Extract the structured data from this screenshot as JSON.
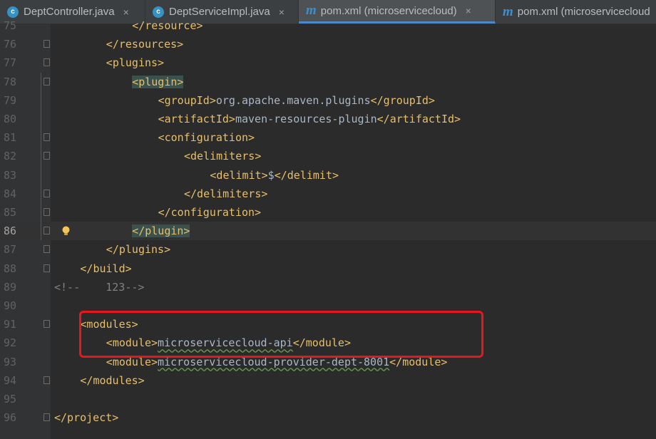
{
  "tabs": [
    {
      "label": "DeptController.java",
      "icon": "class-c-icon",
      "active": false
    },
    {
      "label": "DeptServiceImpl.java",
      "icon": "class-c-icon",
      "active": false
    },
    {
      "label": "pom.xml (microservicecloud)",
      "icon": "maven-m-icon",
      "active": true
    },
    {
      "label": "pom.xml (microservicecloud",
      "icon": "maven-m-icon",
      "active": false
    }
  ],
  "tab_close_glyph": "×",
  "current_line": 86,
  "lines": [
    {
      "n": "75",
      "code": "</resource>"
    },
    {
      "n": "76",
      "code": "</resources>"
    },
    {
      "n": "77",
      "code": "<plugins>"
    },
    {
      "n": "78",
      "code": "<plugin>"
    },
    {
      "n": "79",
      "code": "<groupId>org.apache.maven.plugins</groupId>"
    },
    {
      "n": "80",
      "code": "<artifactId>maven-resources-plugin</artifactId>"
    },
    {
      "n": "81",
      "code": "<configuration>"
    },
    {
      "n": "82",
      "code": "<delimiters>"
    },
    {
      "n": "83",
      "code": "<delimit>$</delimit>"
    },
    {
      "n": "84",
      "code": "</delimiters>"
    },
    {
      "n": "85",
      "code": "</configuration>"
    },
    {
      "n": "86",
      "code": "</plugin>"
    },
    {
      "n": "87",
      "code": "</plugins>"
    },
    {
      "n": "88",
      "code": "</build>"
    },
    {
      "n": "89",
      "code": "<!--    123-->"
    },
    {
      "n": "90",
      "code": ""
    },
    {
      "n": "91",
      "code": "<modules>"
    },
    {
      "n": "92",
      "code": "<module>microservicecloud-api</module>"
    },
    {
      "n": "93",
      "code": "<module>microservicecloud-provider-dept-8001</module>"
    },
    {
      "n": "94",
      "code": "</modules>"
    },
    {
      "n": "95",
      "code": ""
    },
    {
      "n": "96",
      "code": "</project>"
    }
  ],
  "colors": {
    "background": "#2b2b2b",
    "xml_tag": "#e8bf6a",
    "text": "#a9b7c6",
    "comment": "#808080",
    "annotation_box": "#e8171d"
  }
}
